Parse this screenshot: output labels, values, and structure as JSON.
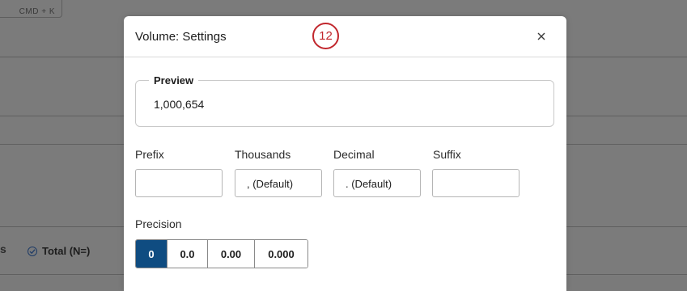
{
  "background": {
    "shortcut": "CMD + K",
    "left_fragment": "s",
    "total_label": "Total (N=)"
  },
  "dialog": {
    "title": "Volume: Settings",
    "step_number": "12",
    "close_icon": "close-icon",
    "preview": {
      "legend": "Preview",
      "value": "1,000,654"
    },
    "fields": [
      {
        "label": "Prefix",
        "value": ""
      },
      {
        "label": "Thousands",
        "value": ", (Default)"
      },
      {
        "label": "Decimal",
        "value": ". (Default)"
      },
      {
        "label": "Suffix",
        "value": ""
      }
    ],
    "precision": {
      "label": "Precision",
      "options": [
        "0",
        "0.0",
        "0.00",
        "0.000"
      ],
      "selected": "0"
    }
  },
  "colors": {
    "accent": "#0f4c81",
    "step_badge": "#c1272d",
    "overlay": "#7b7b7b"
  }
}
